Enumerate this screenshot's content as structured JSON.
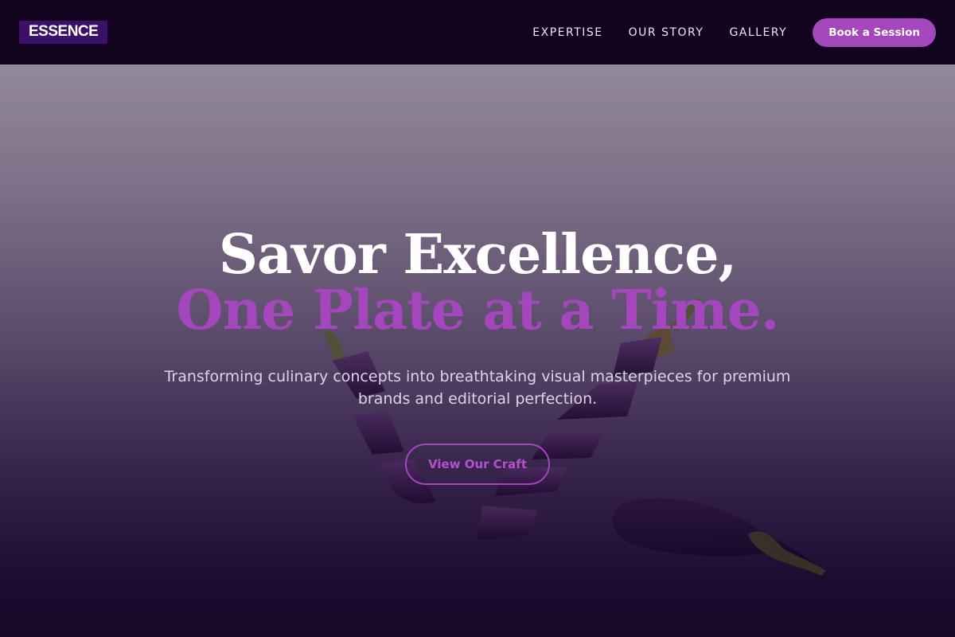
{
  "brand": {
    "logo_text": "ESSENCE"
  },
  "nav": {
    "links": [
      "EXPERTISE",
      "OUR STORY",
      "GALLERY"
    ],
    "cta_label": "Book a Session"
  },
  "hero": {
    "headline_white": "Savor Excellence, ",
    "headline_accent": "One Plate at a Time.",
    "subheadline": "Transforming culinary concepts into breathtaking visual masterpieces for premium brands and editorial perfection.",
    "cta_label": "View Our Craft",
    "photo_subject": "sliced-eggplant-photo"
  },
  "colors": {
    "nav_bg": "#12031f",
    "accent": "#a447bd",
    "logo_bg": "#3c1066",
    "hero_top": "#928999",
    "hero_bottom": "#160828"
  }
}
